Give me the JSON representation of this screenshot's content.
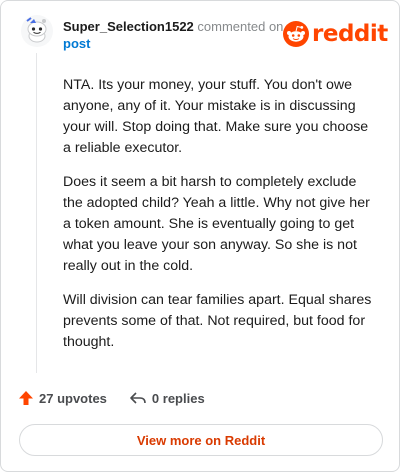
{
  "comment": {
    "username": "Super_Selection1522",
    "action_text": " commented on ",
    "post_link": "post",
    "paragraphs": [
      "NTA. Its your money, your stuff. You don't owe anyone, any of it. Your mistake is in discussing your will. Stop doing that. Make sure you choose a reliable executor.",
      "Does it seem a bit harsh to completely exclude the adopted child? Yeah a little. Why not give her a token amount. She is eventually going to get what you leave your son anyway. So she is not really out in the cold.",
      "Will division can tear families apart. Equal shares prevents some of that. Not required, but food for thought."
    ]
  },
  "brand": {
    "wordmark": "reddit",
    "color": "#ff4500"
  },
  "footer": {
    "upvotes": "27 upvotes",
    "replies": "0 replies"
  },
  "view_more_label": "View more on Reddit",
  "icons": {
    "avatar": "snoo-avatar-icon",
    "logo": "reddit-snoo-logo-icon",
    "upvote": "upvote-arrow-icon",
    "reply": "reply-arrow-icon"
  }
}
